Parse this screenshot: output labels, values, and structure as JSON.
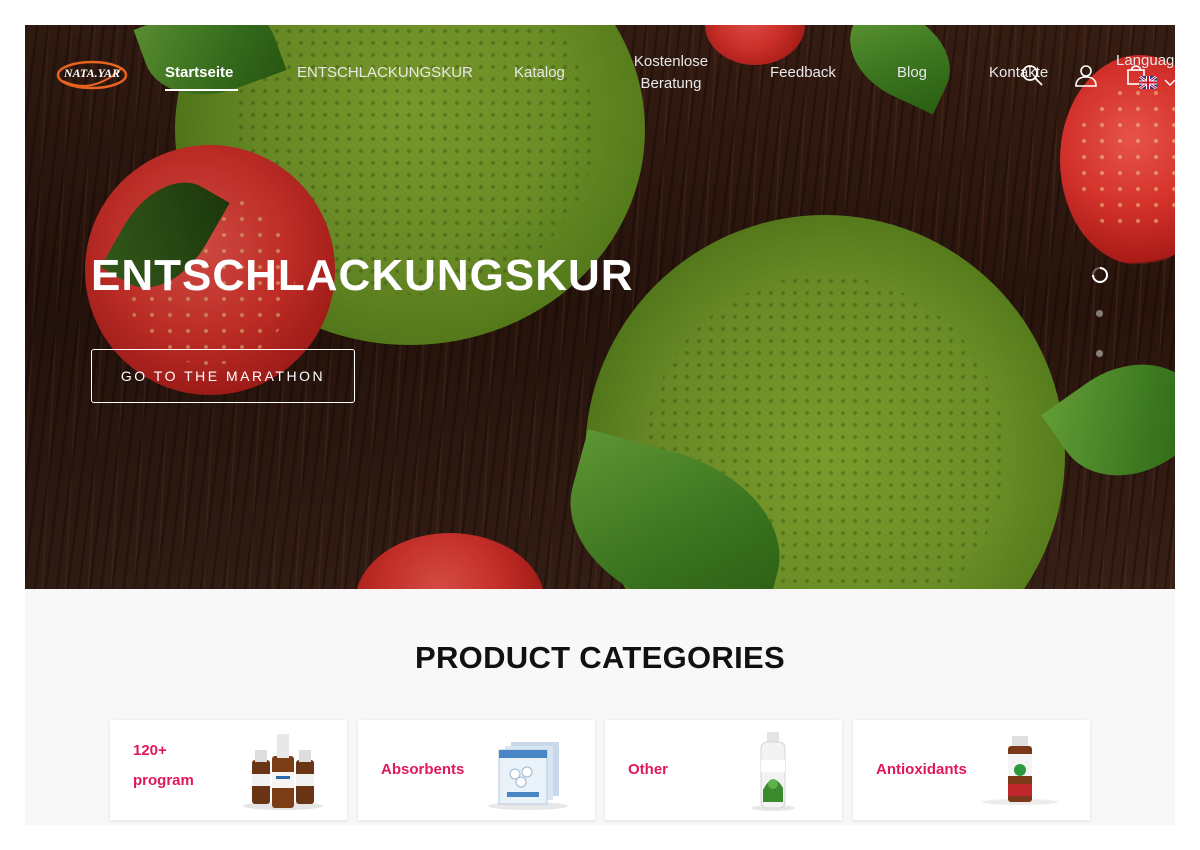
{
  "header": {
    "logo_text": "NATA.YAR",
    "nav": [
      {
        "label": "Startseite",
        "active": true
      },
      {
        "label": "ENTSCHLACKUNGSKUR",
        "active": false
      },
      {
        "label": "Katalog",
        "active": false
      },
      {
        "label": "Kostenlose Beratung",
        "active": false
      },
      {
        "label": "Feedback",
        "active": false
      },
      {
        "label": "Blog",
        "active": false
      },
      {
        "label": "Kontakte",
        "active": false
      }
    ],
    "icons": [
      "search-icon",
      "user-icon",
      "cart-icon"
    ],
    "language_label": "Languag",
    "language_flag": "uk-flag-icon"
  },
  "hero": {
    "title": "ENTSCHLACKUNGSKUR",
    "button_label": "GO TO THE MARATHON",
    "slides_total": 3,
    "active_slide": 1
  },
  "categories": {
    "title": "PRODUCT CATEGORIES",
    "items": [
      {
        "label": "120+ program",
        "image": "serum-bottles"
      },
      {
        "label": "Absorbents",
        "image": "absorbent-packets"
      },
      {
        "label": "Other",
        "image": "shampoo-bottle"
      },
      {
        "label": "Antioxidants",
        "image": "small-vial"
      }
    ]
  },
  "colors": {
    "accent": "#e0185a",
    "nav_text": "#e8e8e8",
    "title_text": "#111111"
  }
}
